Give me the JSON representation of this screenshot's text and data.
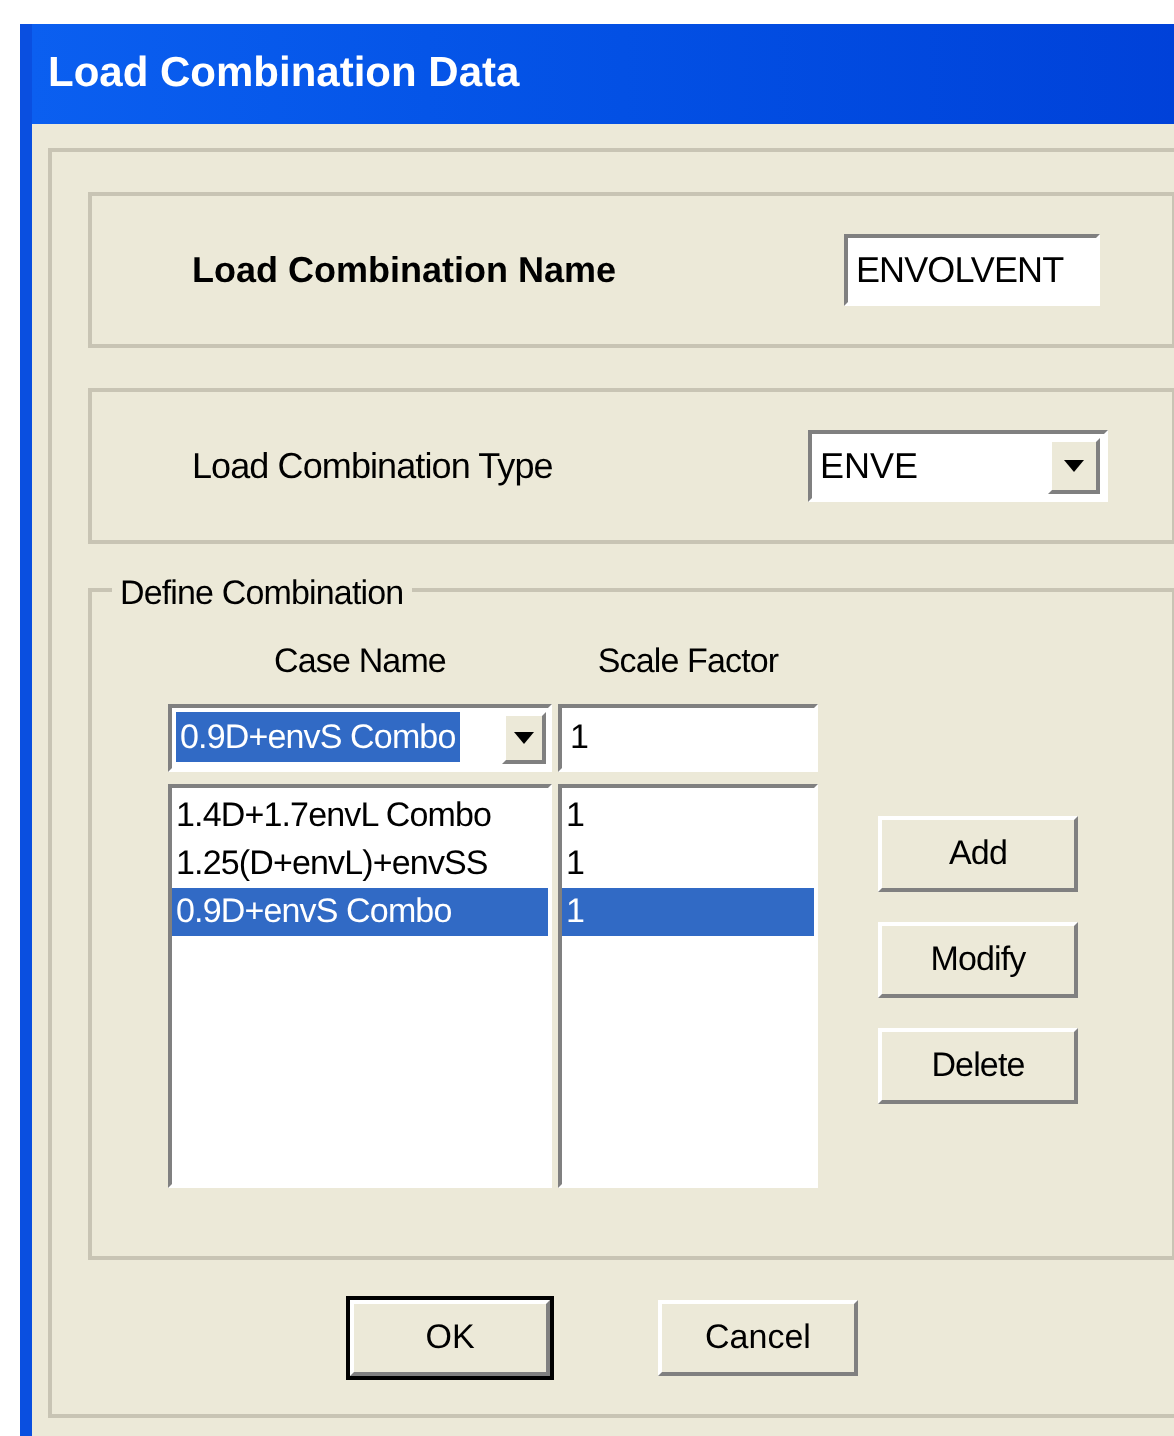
{
  "window": {
    "title": "Load Combination Data"
  },
  "name_field": {
    "label": "Load Combination Name",
    "value": "ENVOLVENT"
  },
  "type_field": {
    "label": "Load Combination Type",
    "value": "ENVE"
  },
  "define_group": {
    "title": "Define Combination",
    "columns": [
      "Case Name",
      "Scale Factor"
    ],
    "case_combo": {
      "value": "0.9D+envS Combo",
      "selected": true
    },
    "factor_field": {
      "value": "1"
    },
    "rows": [
      {
        "case": "1.4D+1.7envL Combo",
        "factor": "1",
        "selected": false
      },
      {
        "case": "1.25(D+envL)+envSS",
        "factor": "1",
        "selected": false
      },
      {
        "case": "0.9D+envS Combo",
        "factor": "1",
        "selected": true
      }
    ],
    "buttons": [
      "Add",
      "Modify",
      "Delete"
    ]
  },
  "footer_buttons": [
    {
      "label": "OK",
      "default": true
    },
    {
      "label": "Cancel",
      "default": false
    }
  ]
}
